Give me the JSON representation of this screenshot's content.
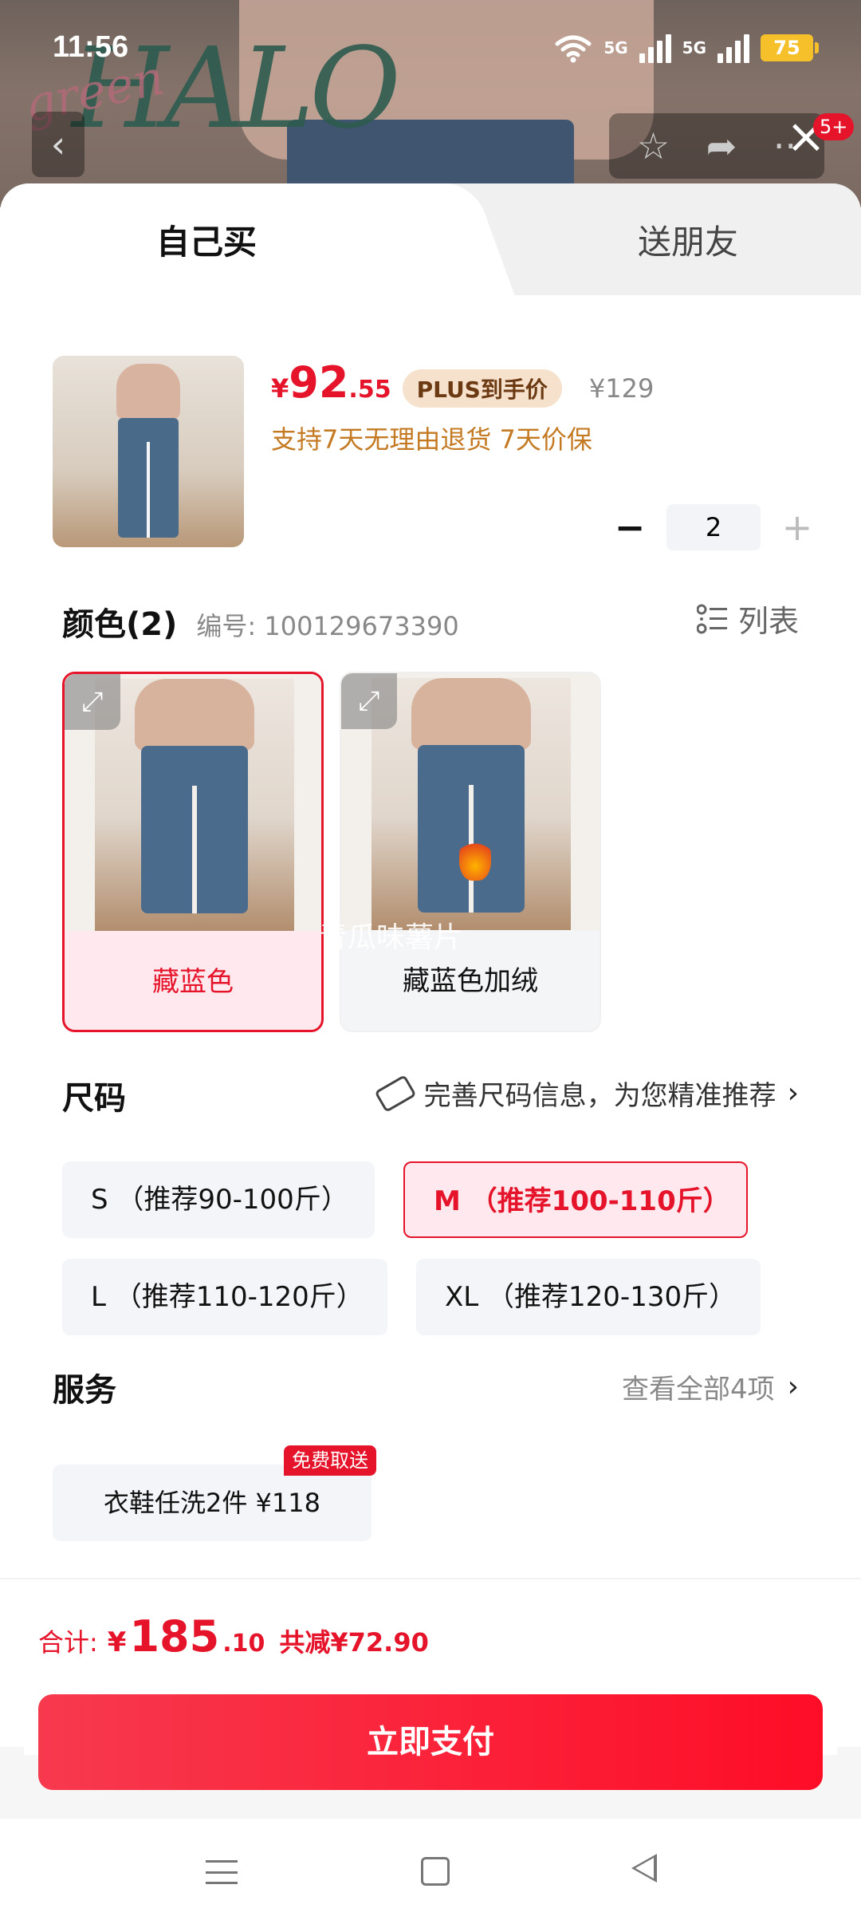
{
  "status_bar": {
    "time": "11:56",
    "net1": "5G",
    "net2": "5G",
    "battery": "75"
  },
  "top_actions": {
    "badge": "5+"
  },
  "backdrop": {
    "brand": "HALO"
  },
  "tabs": [
    {
      "label": "自己买"
    },
    {
      "label": "送朋友"
    }
  ],
  "product": {
    "price_symbol": "¥",
    "price_int": "92",
    "price_dec": ".55",
    "plus_tag": "PLUS到手价",
    "original_price": "¥129",
    "promise": "支持7天无理由退货  7天价保",
    "quantity": "2"
  },
  "color_section": {
    "title": "颜色(2)",
    "sku": "编号: 100129673390",
    "list_toggle": "列表",
    "options": [
      {
        "label": "藏蓝色",
        "selected": true
      },
      {
        "label": "藏蓝色加绒",
        "selected": false
      }
    ],
    "watermark": "青瓜味薯片"
  },
  "size_section": {
    "title": "尺码",
    "hint": "完善尺码信息，为您精准推荐",
    "options": [
      {
        "label": "S （推荐90-100斤）",
        "selected": false
      },
      {
        "label": "M （推荐100-110斤）",
        "selected": true
      },
      {
        "label": "L （推荐110-120斤）",
        "selected": false
      },
      {
        "label": "XL （推荐120-130斤）",
        "selected": false
      }
    ]
  },
  "service_section": {
    "title": "服务",
    "more": "查看全部4项",
    "option": "衣鞋任洗2件 ¥118",
    "badge": "免费取送"
  },
  "total": {
    "label": "合计:",
    "yen": "¥",
    "int": "185",
    "dec": ".10",
    "save": "共减¥72.90"
  },
  "pay_button": "立即支付",
  "colors": {
    "accent": "#e5142a",
    "promise": "#c47a22",
    "plus_tag_bg": "#f6e1cc"
  }
}
